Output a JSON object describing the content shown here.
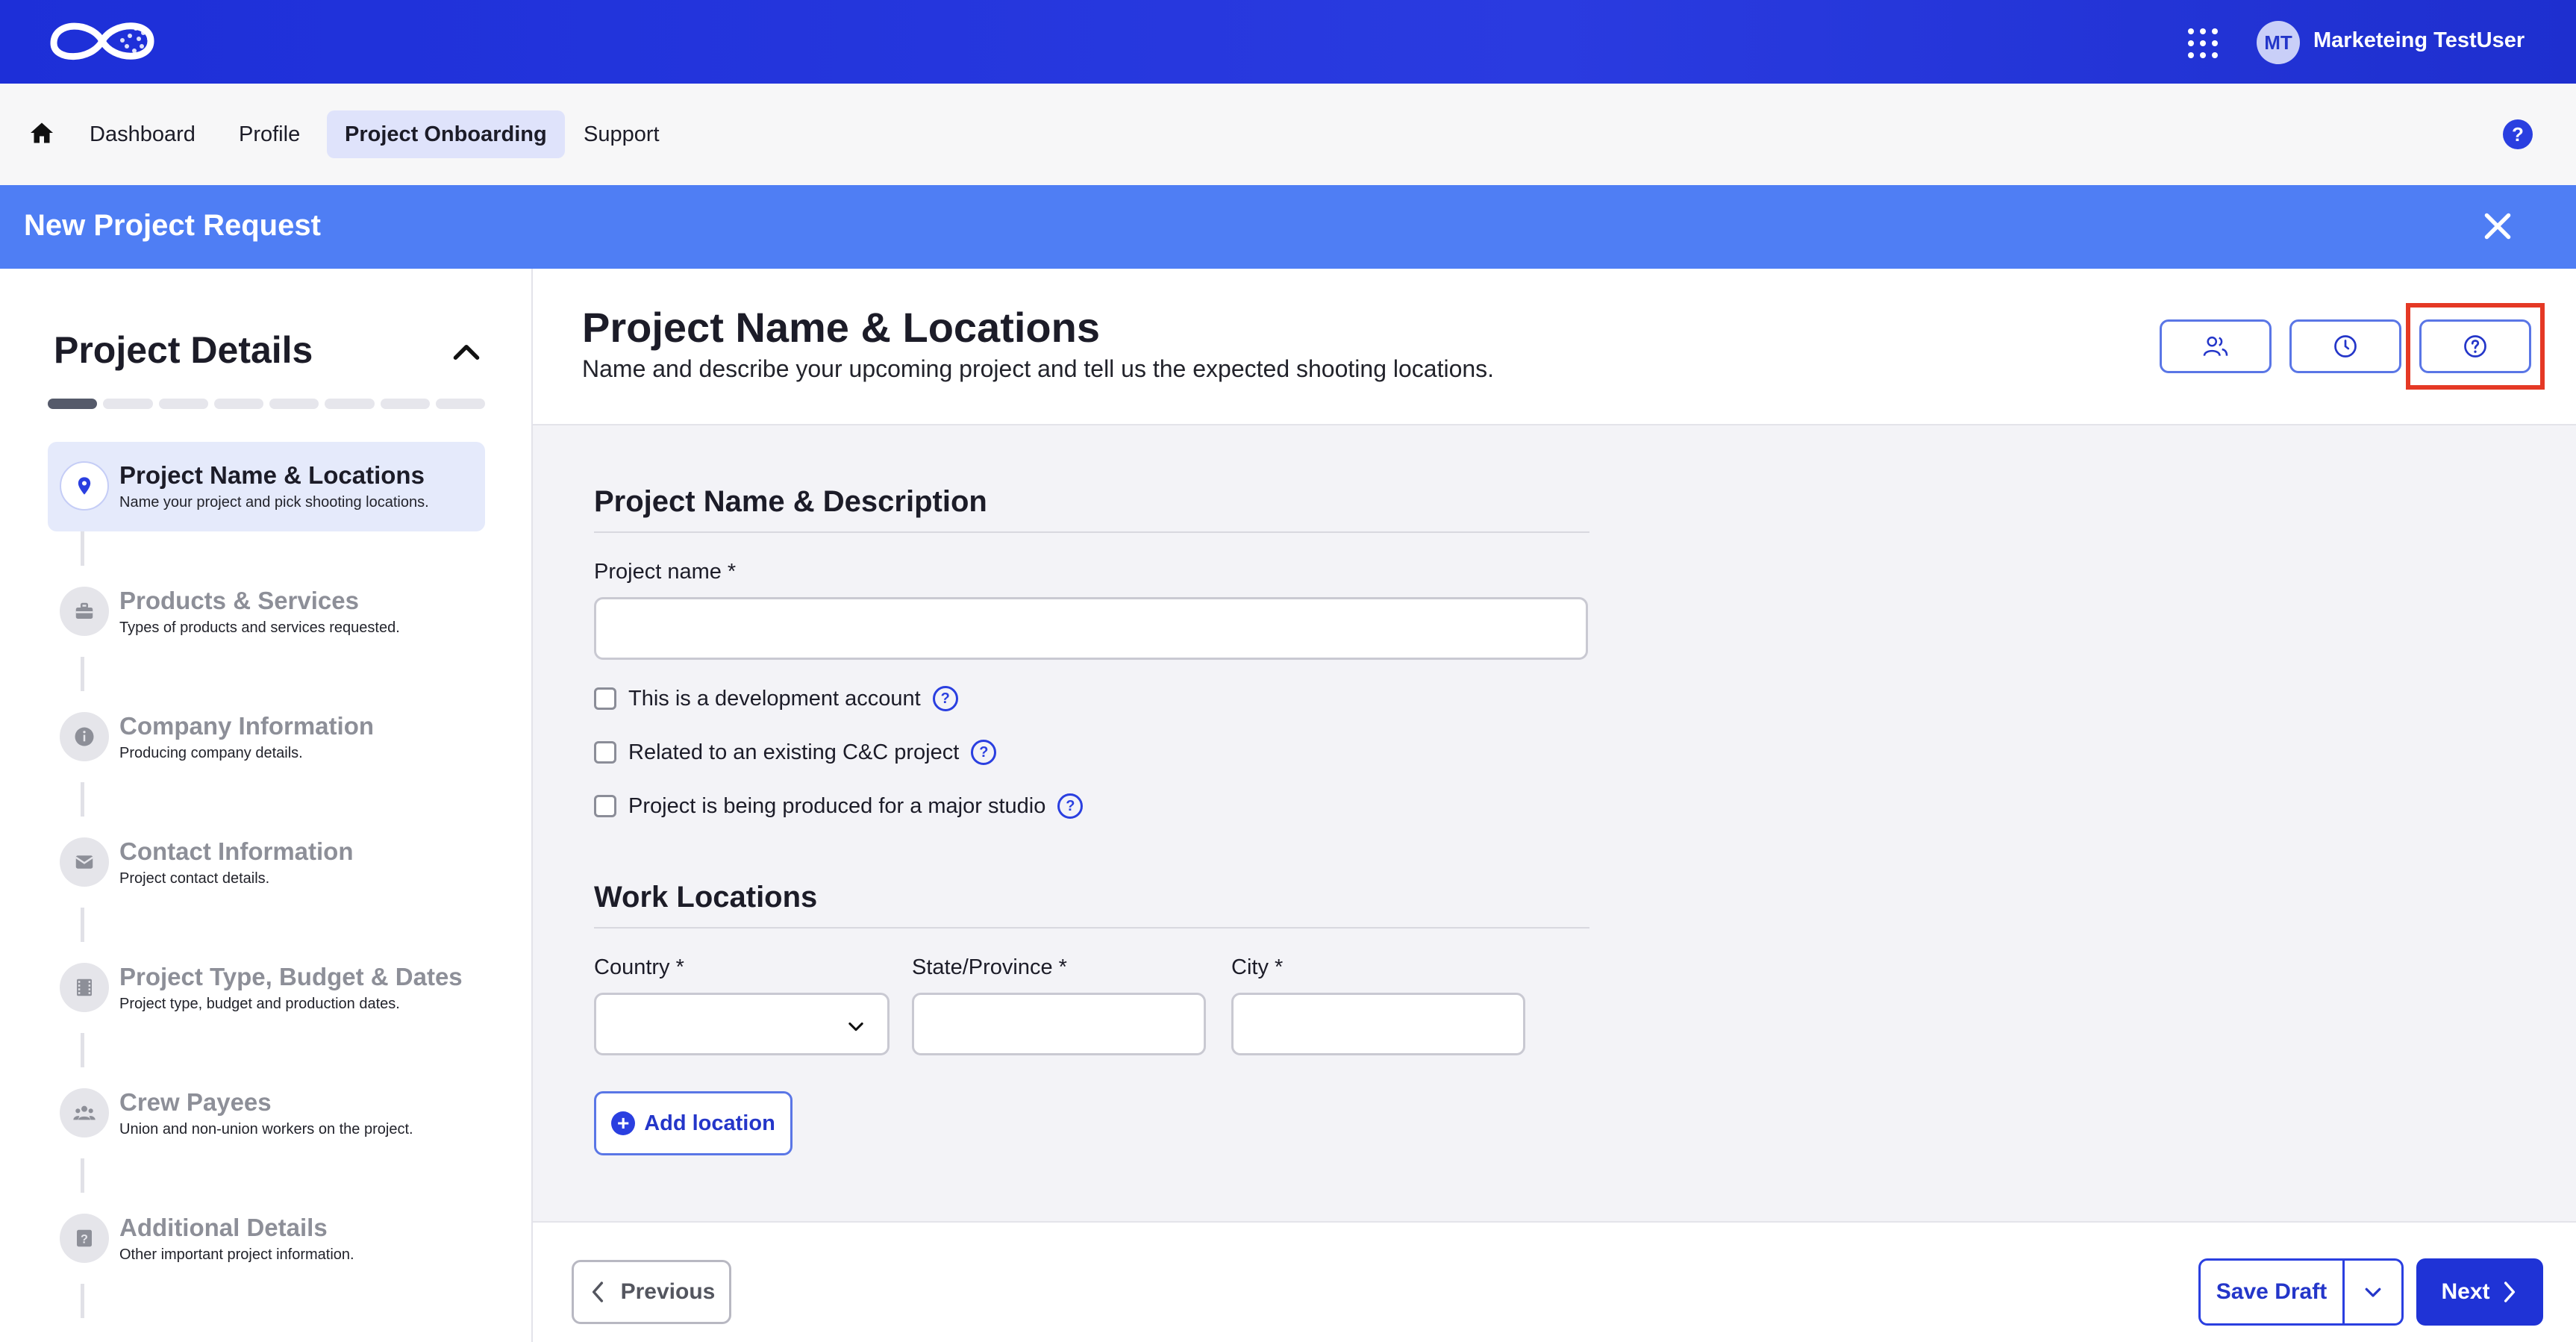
{
  "topbar": {
    "user_initials": "MT",
    "user_name": "Marketeing TestUser"
  },
  "nav": {
    "items": [
      "Dashboard",
      "Profile",
      "Project Onboarding",
      "Support"
    ],
    "active": "Project Onboarding",
    "help": "?"
  },
  "request_bar": {
    "title": "New Project Request"
  },
  "sidebar": {
    "title": "Project Details",
    "progress_total_steps": 8,
    "progress_current_step": 1,
    "steps": [
      {
        "name": "Project Name & Locations",
        "desc": "Name your project and pick shooting locations.",
        "icon": "location-pin-icon"
      },
      {
        "name": "Products & Services",
        "desc": "Types of products and services requested.",
        "icon": "briefcase-icon"
      },
      {
        "name": "Company Information",
        "desc": "Producing company details.",
        "icon": "info-icon"
      },
      {
        "name": "Contact Information",
        "desc": "Project contact details.",
        "icon": "envelope-icon"
      },
      {
        "name": "Project Type, Budget & Dates",
        "desc": "Project type, budget and production dates.",
        "icon": "film-icon"
      },
      {
        "name": "Crew Payees",
        "desc": "Union and non-union workers on the project.",
        "icon": "people-icon"
      },
      {
        "name": "Additional Details",
        "desc": "Other important project information.",
        "icon": "question-box-icon"
      }
    ]
  },
  "main": {
    "title": "Project Name & Locations",
    "subtitle": "Name and describe your upcoming project and tell us the expected shooting locations.",
    "header_buttons": [
      "users-icon",
      "clock-icon",
      "help-icon"
    ],
    "section1_title": "Project Name & Description",
    "project_name_label": "Project name *",
    "project_name_value": "",
    "checkboxes": [
      {
        "label": "This is a development account",
        "checked": false
      },
      {
        "label": "Related to an existing C&C project",
        "checked": false
      },
      {
        "label": "Project is being produced for a major studio",
        "checked": false
      }
    ],
    "section2_title": "Work Locations",
    "country_label": "Country *",
    "state_label": "State/Province *",
    "city_label": "City *",
    "country_value": "",
    "state_value": "",
    "city_value": "",
    "add_location_label": "Add location"
  },
  "footer": {
    "previous_label": "Previous",
    "save_draft_label": "Save Draft",
    "next_label": "Next"
  },
  "colors": {
    "brand": "#1f33d6",
    "header_blue": "#4f7ef4",
    "highlight": "#e53925"
  }
}
